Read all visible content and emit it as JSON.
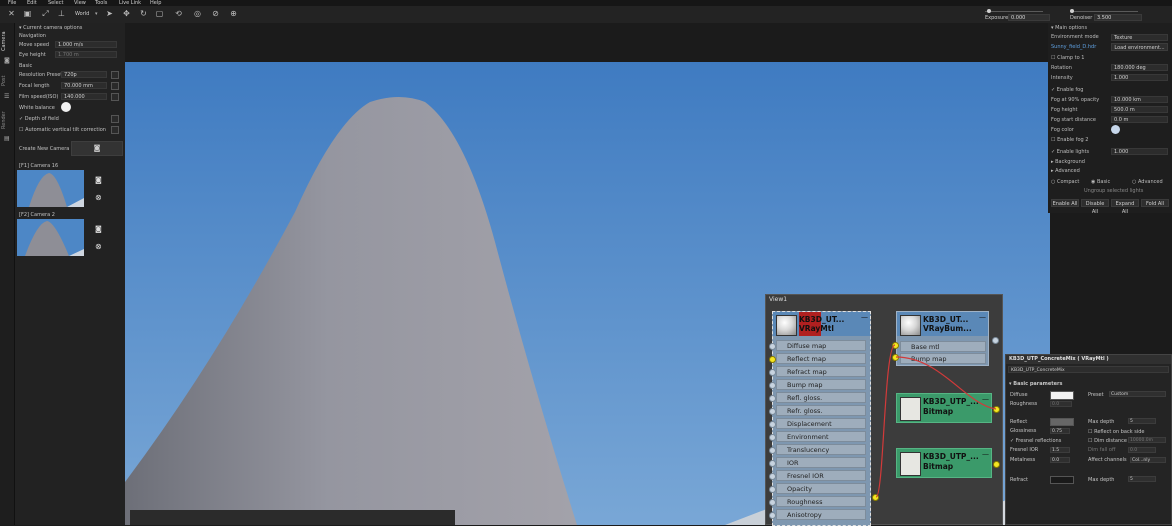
{
  "menubar": {
    "items": [
      "File",
      "Edit",
      "Select",
      "View",
      "Tools",
      "Live Link",
      "Help"
    ]
  },
  "toolbar": {
    "space_label": "World",
    "exposure_label": "Exposure",
    "exposure_value": "0.000",
    "denoiser_label": "Denoiser",
    "denoiser_value": "3.500"
  },
  "left_tabs": [
    "Camera",
    "Post",
    "Render"
  ],
  "camera_panel": {
    "section_title": "Current camera options",
    "navigation_label": "Navigation",
    "move_speed_label": "Move speed",
    "move_speed_value": "1.000 m/s",
    "eye_height_label": "Eye height",
    "eye_height_value": "1.700 m",
    "basic_label": "Basic",
    "resolution_label": "Resolution Preset",
    "resolution_value": "720p",
    "focal_label": "Focal length",
    "focal_value": "70.000 mm",
    "film_label": "Film speed(ISO)",
    "film_value": "140.000",
    "white_balance_label": "White balance",
    "dof_label": "Depth of field",
    "vertical_tilt_label": "Automatic vertical tilt correction",
    "create_label": "Create New Camera",
    "cameras": [
      {
        "label": "[F1] Camera 16"
      },
      {
        "label": "[F2] Camera 2"
      }
    ]
  },
  "environment_panel": {
    "main_options": "Main options",
    "env_mode_label": "Environment mode",
    "env_mode_value": "Texture",
    "hdr_file": "Sunny_field_D.hdr",
    "load_env_label": "Load environment...",
    "clamp_label": "Clamp to 1",
    "rotation_label": "Rotation",
    "rotation_value": "180.000 deg",
    "intensity_label": "Intensity",
    "intensity_value": "1.000",
    "enable_fog_label": "Enable fog",
    "fog_opacity_label": "Fog at 90% opacity",
    "fog_opacity_value": "10.000 km",
    "fog_height_label": "Fog height",
    "fog_height_value": "500.0 m",
    "fog_start_label": "Fog start distance",
    "fog_start_value": "0.0 m",
    "fog_color_label": "Fog color",
    "enable_fog2_label": "Enable fog 2",
    "enable_lights_label": "Enable lights",
    "enable_lights_value": "1.000",
    "background_label": "Background",
    "advanced_label": "Advanced",
    "compact_label": "Compact",
    "basic_label": "Basic",
    "advanced_radio_label": "Advanced",
    "ungroup_label": "Ungroup selected lights",
    "buttons": [
      "Enable All",
      "Disable All",
      "Expand All",
      "Fold All"
    ]
  },
  "node_editor": {
    "title": "View1",
    "vraymtl": {
      "title1": "KB3D_UT...",
      "title2": "VRayMtl",
      "slots": [
        "Diffuse map",
        "Reflect map",
        "Refract map",
        "Bump map",
        "Refl. gloss.",
        "Refr. gloss.",
        "Displacement",
        "Environment",
        "Translucency",
        "IOR",
        "Fresnel IOR",
        "Opacity",
        "Roughness",
        "Anisotropy"
      ]
    },
    "bump": {
      "title1": "KB3D_UT...",
      "title2": "VRayBum...",
      "slots": [
        "Base mtl",
        "Bump map"
      ]
    },
    "bitmap1": {
      "title1": "KB3D_UTP_...",
      "title2": "Bitmap"
    },
    "bitmap2": {
      "title1": "KB3D_UTP_...",
      "title2": "Bitmap"
    }
  },
  "material_editor": {
    "title": "KB3D_UTP_ConcreteMix ( VRayMtl )",
    "name": "KB3D_UTP_ConcreteMix",
    "basic_params": "Basic parameters",
    "diffuse_label": "Diffuse",
    "preset_label": "Preset",
    "preset_value": "Custom",
    "roughness_label": "Roughness",
    "roughness_value": "0.0",
    "reflect_label": "Reflect",
    "max_depth_label": "Max depth",
    "max_depth_value": "5",
    "glossiness_label": "Glossiness",
    "glossiness_value": "0.75",
    "reflect_back_label": "Reflect on back side",
    "fresnel_label": "Fresnel reflections",
    "dim_distance_label": "Dim distance",
    "dim_distance_value": "10000.0m",
    "fresnel_ior_label": "Fresnel IOR",
    "fresnel_ior_value": "1.5",
    "dim_falloff_label": "Dim fall off",
    "dim_falloff_value": "0.0",
    "metalness_label": "Metalness",
    "metalness_value": "0.0",
    "affect_label": "Affect channels",
    "affect_value": "Col...nly",
    "refract_label": "Refract",
    "refract_max_depth_label": "Max depth",
    "refract_max_depth_value": "5"
  },
  "colors": {
    "sky": "#4c86c6",
    "node_header": "#5a88b7",
    "bitmap_header": "#3b9a6a",
    "wire_red": "#d23a3a",
    "port_yellow": "#f5e623"
  }
}
